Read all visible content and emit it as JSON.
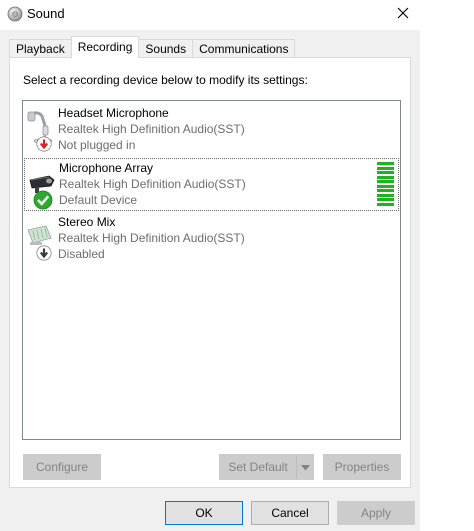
{
  "window": {
    "title": "Sound",
    "icon": "speaker-icon",
    "close_icon": "close-icon"
  },
  "tabs": [
    {
      "label": "Playback",
      "active": false
    },
    {
      "label": "Recording",
      "active": true
    },
    {
      "label": "Sounds",
      "active": false
    },
    {
      "label": "Communications",
      "active": false
    }
  ],
  "panel": {
    "instruction": "Select a recording device below to modify its settings:",
    "devices": [
      {
        "name": "Headset Microphone",
        "driver": "Realtek High Definition Audio(SST)",
        "status": "Not plugged in",
        "icon": "headset-microphone-icon",
        "status_icon": "red-down-arrow-icon",
        "selected": false
      },
      {
        "name": "Microphone Array",
        "driver": "Realtek High Definition Audio(SST)",
        "status": "Default Device",
        "icon": "microphone-array-icon",
        "status_icon": "green-checkmark-icon",
        "selected": true,
        "level": 1.0
      },
      {
        "name": "Stereo Mix",
        "driver": "Realtek High Definition Audio(SST)",
        "status": "Disabled",
        "icon": "stereo-mix-board-icon",
        "status_icon": "gray-down-arrow-icon",
        "selected": false
      }
    ],
    "buttons": {
      "configure": "Configure",
      "set_default": "Set Default",
      "properties": "Properties"
    }
  },
  "footer": {
    "ok": "OK",
    "cancel": "Cancel",
    "apply": "Apply"
  },
  "colors": {
    "level_green": "#21b221",
    "focus_blue": "#0078d7",
    "disabled_text": "#838383"
  }
}
